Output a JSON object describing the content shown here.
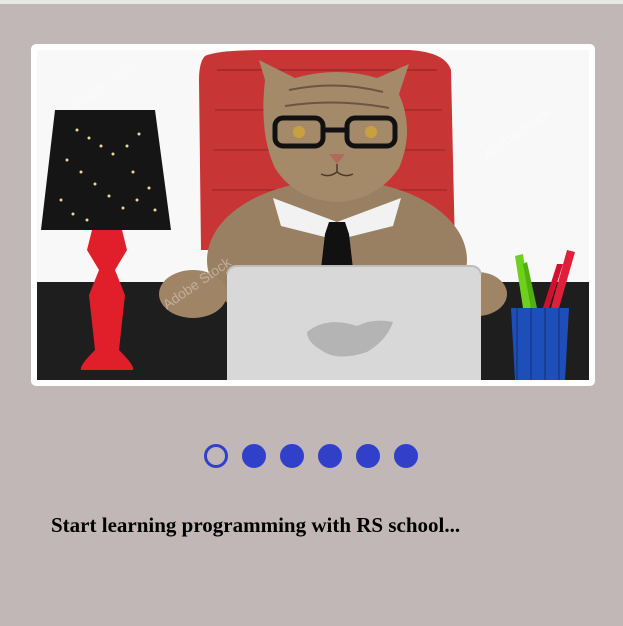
{
  "slider": {
    "image_alt": "Cat wearing glasses and a tie sitting at a laptop",
    "watermark": "Adobe Stock",
    "active_index": 0,
    "dots": [
      {
        "active": true
      },
      {
        "active": false
      },
      {
        "active": false
      },
      {
        "active": false
      },
      {
        "active": false
      },
      {
        "active": false
      }
    ]
  },
  "caption": {
    "text": "Start learning programming with RS school..."
  },
  "colors": {
    "background": "#c0b7b6",
    "dot": "#3040c8",
    "caption": "#000000"
  }
}
